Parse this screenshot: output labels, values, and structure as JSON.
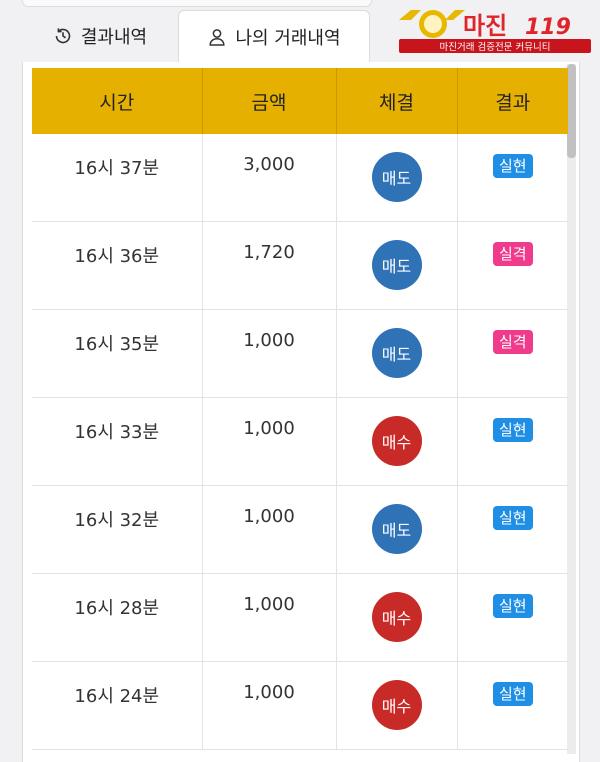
{
  "tabs": [
    {
      "label": "결과내역",
      "icon": "history-icon"
    },
    {
      "label": "나의 거래내역",
      "icon": "user-icon"
    }
  ],
  "logo": {
    "title": "마진",
    "number": "119",
    "subtitle": "마진거래 검증전문 커뮤니티",
    "colors": {
      "title": "#e0242b",
      "emblem": "#e6b800",
      "ribbon": "#c8141d"
    }
  },
  "table": {
    "headers": [
      "시간",
      "금액",
      "체결",
      "결과"
    ],
    "rows": [
      {
        "time": "16시 37분",
        "amount": "3,000",
        "trade": "매도",
        "result": "실현"
      },
      {
        "time": "16시 36분",
        "amount": "1,720",
        "trade": "매도",
        "result": "실격"
      },
      {
        "time": "16시 35분",
        "amount": "1,000",
        "trade": "매도",
        "result": "실격"
      },
      {
        "time": "16시 33분",
        "amount": "1,000",
        "trade": "매수",
        "result": "실현"
      },
      {
        "time": "16시 32분",
        "amount": "1,000",
        "trade": "매도",
        "result": "실현"
      },
      {
        "time": "16시 28분",
        "amount": "1,000",
        "trade": "매수",
        "result": "실현"
      },
      {
        "time": "16시 24분",
        "amount": "1,000",
        "trade": "매수",
        "result": "실현"
      }
    ]
  },
  "colors": {
    "header_bg": "#e6b000",
    "sell": "#2f72b5",
    "buy": "#c82b27",
    "win": "#1f8fe6",
    "lose": "#f03a8c"
  }
}
